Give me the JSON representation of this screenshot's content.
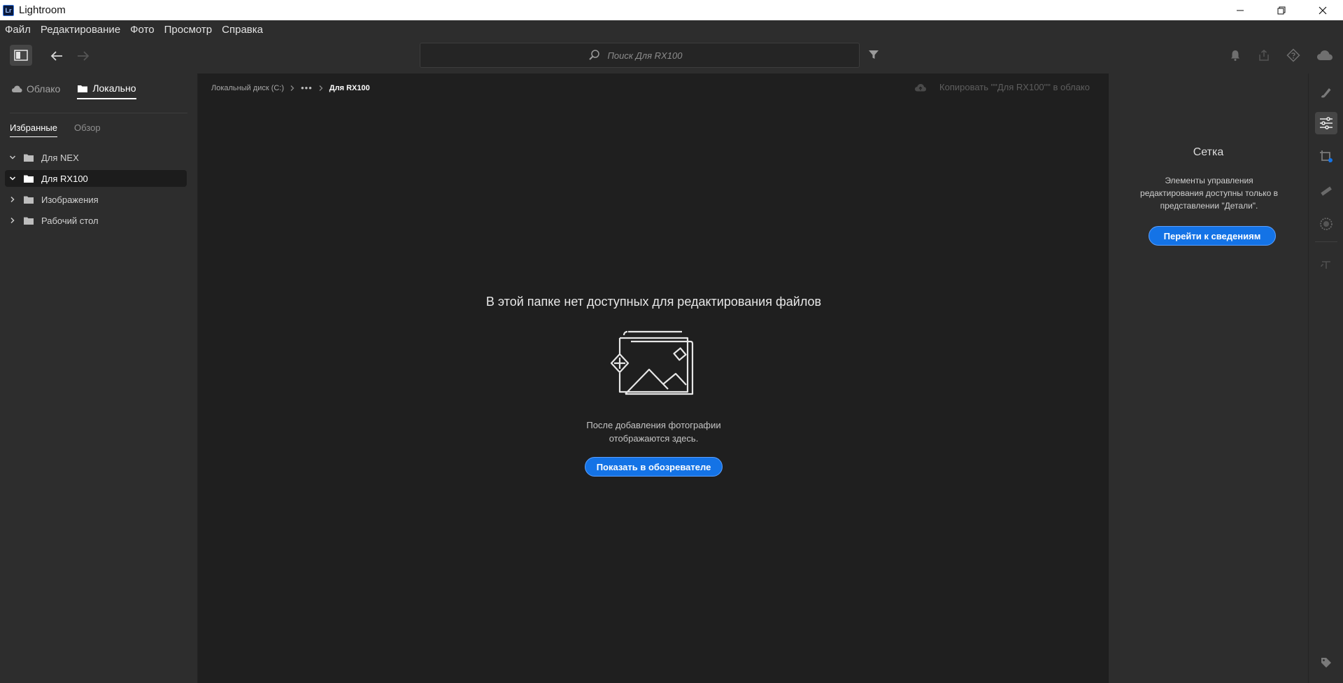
{
  "window": {
    "title": "Lightroom",
    "logo_text": "Lr",
    "controls": [
      "minimize",
      "restore",
      "close"
    ]
  },
  "menu": {
    "items": [
      "Файл",
      "Редактирование",
      "Фото",
      "Просмотр",
      "Справка"
    ]
  },
  "toolbar": {
    "search_placeholder": "Поиск Для RX100",
    "icons": [
      "panel-toggle-icon",
      "back-arrow-icon",
      "forward-arrow-icon",
      "search-icon",
      "filter-icon",
      "bell-icon",
      "share-icon",
      "help-diamond-icon",
      "cloud-icon"
    ]
  },
  "sources": {
    "tabs": [
      {
        "label": "Облако",
        "icon": "cloud-icon",
        "active": false
      },
      {
        "label": "Локально",
        "icon": "folder-icon",
        "active": true
      }
    ],
    "subtabs": [
      {
        "label": "Избранные",
        "active": true
      },
      {
        "label": "Обзор",
        "active": false
      }
    ],
    "folders": [
      {
        "label": "Для NEX",
        "expanded": true,
        "selected": false
      },
      {
        "label": "Для RX100",
        "expanded": true,
        "selected": true
      },
      {
        "label": "Изображения",
        "expanded": false,
        "selected": false
      },
      {
        "label": "Рабочий стол",
        "expanded": false,
        "selected": false
      }
    ]
  },
  "main": {
    "breadcrumb": {
      "root": "Локальный диск (C:)",
      "ellipsis": "•••",
      "current": "Для RX100"
    },
    "copy_to_cloud": "Копировать \"\"Для RX100\"\" в облако",
    "empty_title": "В этой папке нет доступных для редактирования файлов",
    "empty_desc": "После добавления фотографии отображаются здесь.",
    "show_in_explorer": "Показать в обозревателе"
  },
  "right_panel": {
    "title": "Сетка",
    "desc": "Элементы управления редактирования доступны только в представлении \"Детали\".",
    "button": "Перейти к сведениям"
  },
  "rail": {
    "icons": [
      "brush-icon",
      "sliders-icon",
      "crop-icon",
      "healing-icon",
      "masking-icon",
      "versions-icon",
      "tag-icon"
    ]
  },
  "colors": {
    "accent": "#1473e6",
    "panel": "#2d2d2d",
    "canvas": "#1f1f1f"
  }
}
